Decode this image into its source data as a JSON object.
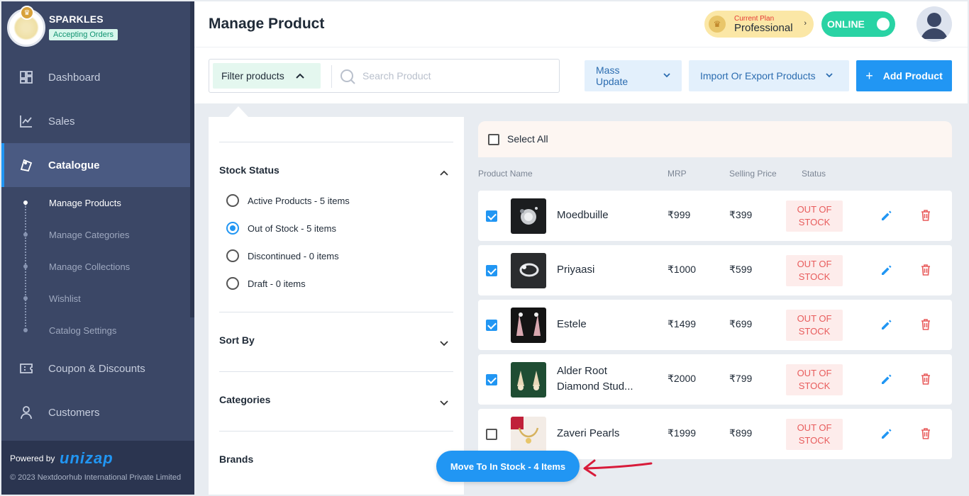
{
  "sidebar": {
    "brand_name": "SPARKLES",
    "store_status": "Accepting Orders",
    "nav": [
      {
        "label": "Dashboard",
        "icon": "dashboard-icon"
      },
      {
        "label": "Sales",
        "icon": "chart-line-icon"
      },
      {
        "label": "Catalogue",
        "icon": "catalogue-icon",
        "active": true
      },
      {
        "label": "Coupon & Discounts",
        "icon": "coupon-icon"
      },
      {
        "label": "Customers",
        "icon": "user-icon"
      }
    ],
    "catalogue_sub": [
      {
        "label": "Manage Products",
        "active": true
      },
      {
        "label": "Manage Categories"
      },
      {
        "label": "Manage Collections"
      },
      {
        "label": "Wishlist"
      },
      {
        "label": "Catalog Settings"
      }
    ],
    "powered_by": "Powered by",
    "powered_logo": "unizap",
    "copyright": "© 2023 Nextdoorhub International Private Limited"
  },
  "header": {
    "title": "Manage Product",
    "plan_label": "Current Plan",
    "plan_name": "Professional",
    "online_label": "ONLINE"
  },
  "toolbar": {
    "filter_label": "Filter products",
    "search_placeholder": "Search Product",
    "mass_update_label": "Mass Update",
    "import_export_label": "Import Or Export Products",
    "add_product_label": "Add Product"
  },
  "filters": {
    "stock_status_title": "Stock Status",
    "stock_options": [
      {
        "label": "Active Products - 5 items",
        "checked": false
      },
      {
        "label": "Out of Stock - 5 items",
        "checked": true
      },
      {
        "label": "Discontinued - 0 items",
        "checked": false
      },
      {
        "label": "Draft - 0 items",
        "checked": false
      }
    ],
    "sort_by_title": "Sort By",
    "categories_title": "Categories",
    "brands_title": "Brands"
  },
  "products": {
    "select_all_label": "Select All",
    "columns": {
      "name": "Product Name",
      "mrp": "MRP",
      "selling_price": "Selling Price",
      "status": "Status"
    },
    "rows": [
      {
        "name": "Moedbuille",
        "mrp": "₹999",
        "selling_price": "₹399",
        "status": "OUT OF STOCK",
        "checked": true
      },
      {
        "name": "Priyaasi",
        "mrp": "₹1000",
        "selling_price": "₹599",
        "status": "OUT OF STOCK",
        "checked": true
      },
      {
        "name": "Estele",
        "mrp": "₹1499",
        "selling_price": "₹699",
        "status": "OUT OF STOCK",
        "checked": true
      },
      {
        "name": "Alder Root Diamond Stud...",
        "mrp": "₹2000",
        "selling_price": "₹799",
        "status": "OUT OF STOCK",
        "checked": true
      },
      {
        "name": "Zaveri Pearls",
        "mrp": "₹1999",
        "selling_price": "₹899",
        "status": "OUT OF STOCK",
        "checked": false
      }
    ]
  },
  "move_button_label": "Move To In Stock - 4 Items",
  "colors": {
    "accent": "#2196f3",
    "sidebar": "#3b4766",
    "online": "#29d3a4",
    "out_of_stock": "#e85c5c"
  }
}
